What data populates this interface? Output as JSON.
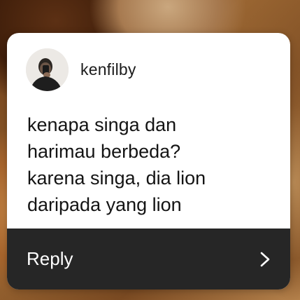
{
  "card": {
    "username": "kenfilby",
    "message_lines": [
      "kenapa singa dan",
      "harimau berbeda?",
      "karena singa, dia lion",
      "daripada yang lion"
    ]
  },
  "reply": {
    "label": "Reply",
    "icon": "chevron-right-icon"
  },
  "colors": {
    "card_background": "#ffffff",
    "reply_bar": "#262626",
    "text": "#141414",
    "reply_text": "#ffffff"
  }
}
